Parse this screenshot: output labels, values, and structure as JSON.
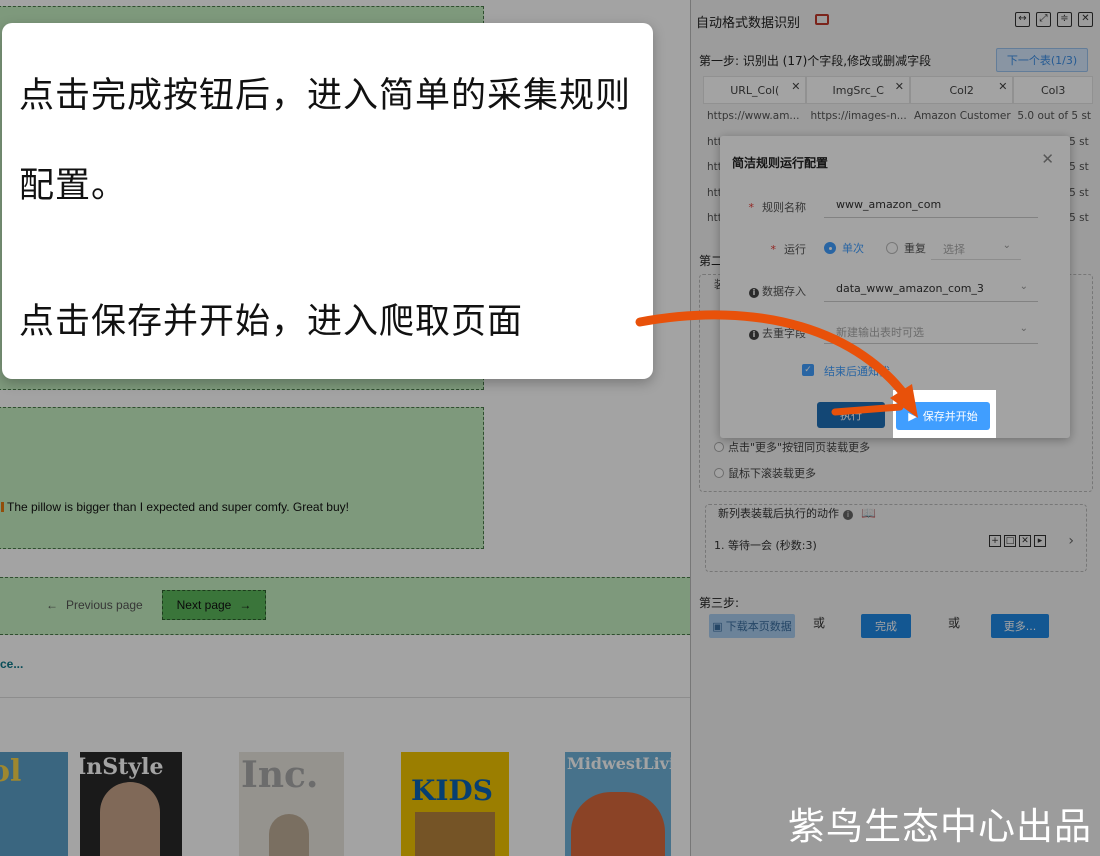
{
  "page": {
    "review_text": "The pillow is bigger than I expected and super comfy. Great buy!",
    "prev_label": "Previous page",
    "next_label": "Next page",
    "see_more": "ce...",
    "magazines": [
      "ol",
      "InStyle",
      "Inc.",
      "KIDS",
      "MidwestLiving"
    ]
  },
  "panel": {
    "title": "自动格式数据识别",
    "step1_text": "第一步: 识别出 (17)个字段,修改或删减字段",
    "next_table": "下一个表(1/3)",
    "columns": [
      "URL_Col(",
      "ImgSrc_C",
      "Col2",
      "Col3"
    ],
    "rows": [
      [
        "https://www.am...",
        "https://images-n...",
        "Amazon Customer",
        "5.0 out of 5 st"
      ],
      [
        "htt",
        "",
        "",
        "5 st"
      ],
      [
        "htt",
        "",
        "",
        "5 st"
      ],
      [
        "htt",
        "",
        "",
        "5 st"
      ],
      [
        "htt",
        "",
        "",
        "5 st"
      ]
    ],
    "step2_text": "第二",
    "step2_box_title": "装",
    "options": [
      "点击\"更多\"按钮同页装载更多",
      "鼠标下滚装载更多"
    ],
    "after_title": "新列表装载后执行的动作",
    "action": "1. 等待一会 (秒数:3)",
    "step3_text": "第三步:",
    "download_btn": "下载本页数据",
    "or1": "或",
    "done_btn": "完成",
    "or2": "或",
    "more_btn": "更多..."
  },
  "modal": {
    "title": "简洁规则运行配置",
    "rule_name_label": "规则名称",
    "rule_name_value": "www_amazon_com",
    "run_label": "运行",
    "run_once": "单次",
    "run_repeat": "重复",
    "repeat_select_placeholder": "选择",
    "storage_label": "数据存入",
    "storage_value": "data_www_amazon_com_3",
    "dedupe_label": "去重字段",
    "dedupe_placeholder": "新建输出表时可选",
    "notify_label": "结束后通知我",
    "cancel_label": "执行",
    "save_label": "保存并开始"
  },
  "callout": {
    "line1": "点击完成按钮后，进入简单的采集规则",
    "line2": "配置。",
    "line3": "点击保存并开始，进入爬取页面"
  },
  "watermark": "紫鸟生态中心出品",
  "colors": {
    "accent": "#409eff",
    "arrow": "#e8510a",
    "highlight_green": "#c6efc2"
  }
}
